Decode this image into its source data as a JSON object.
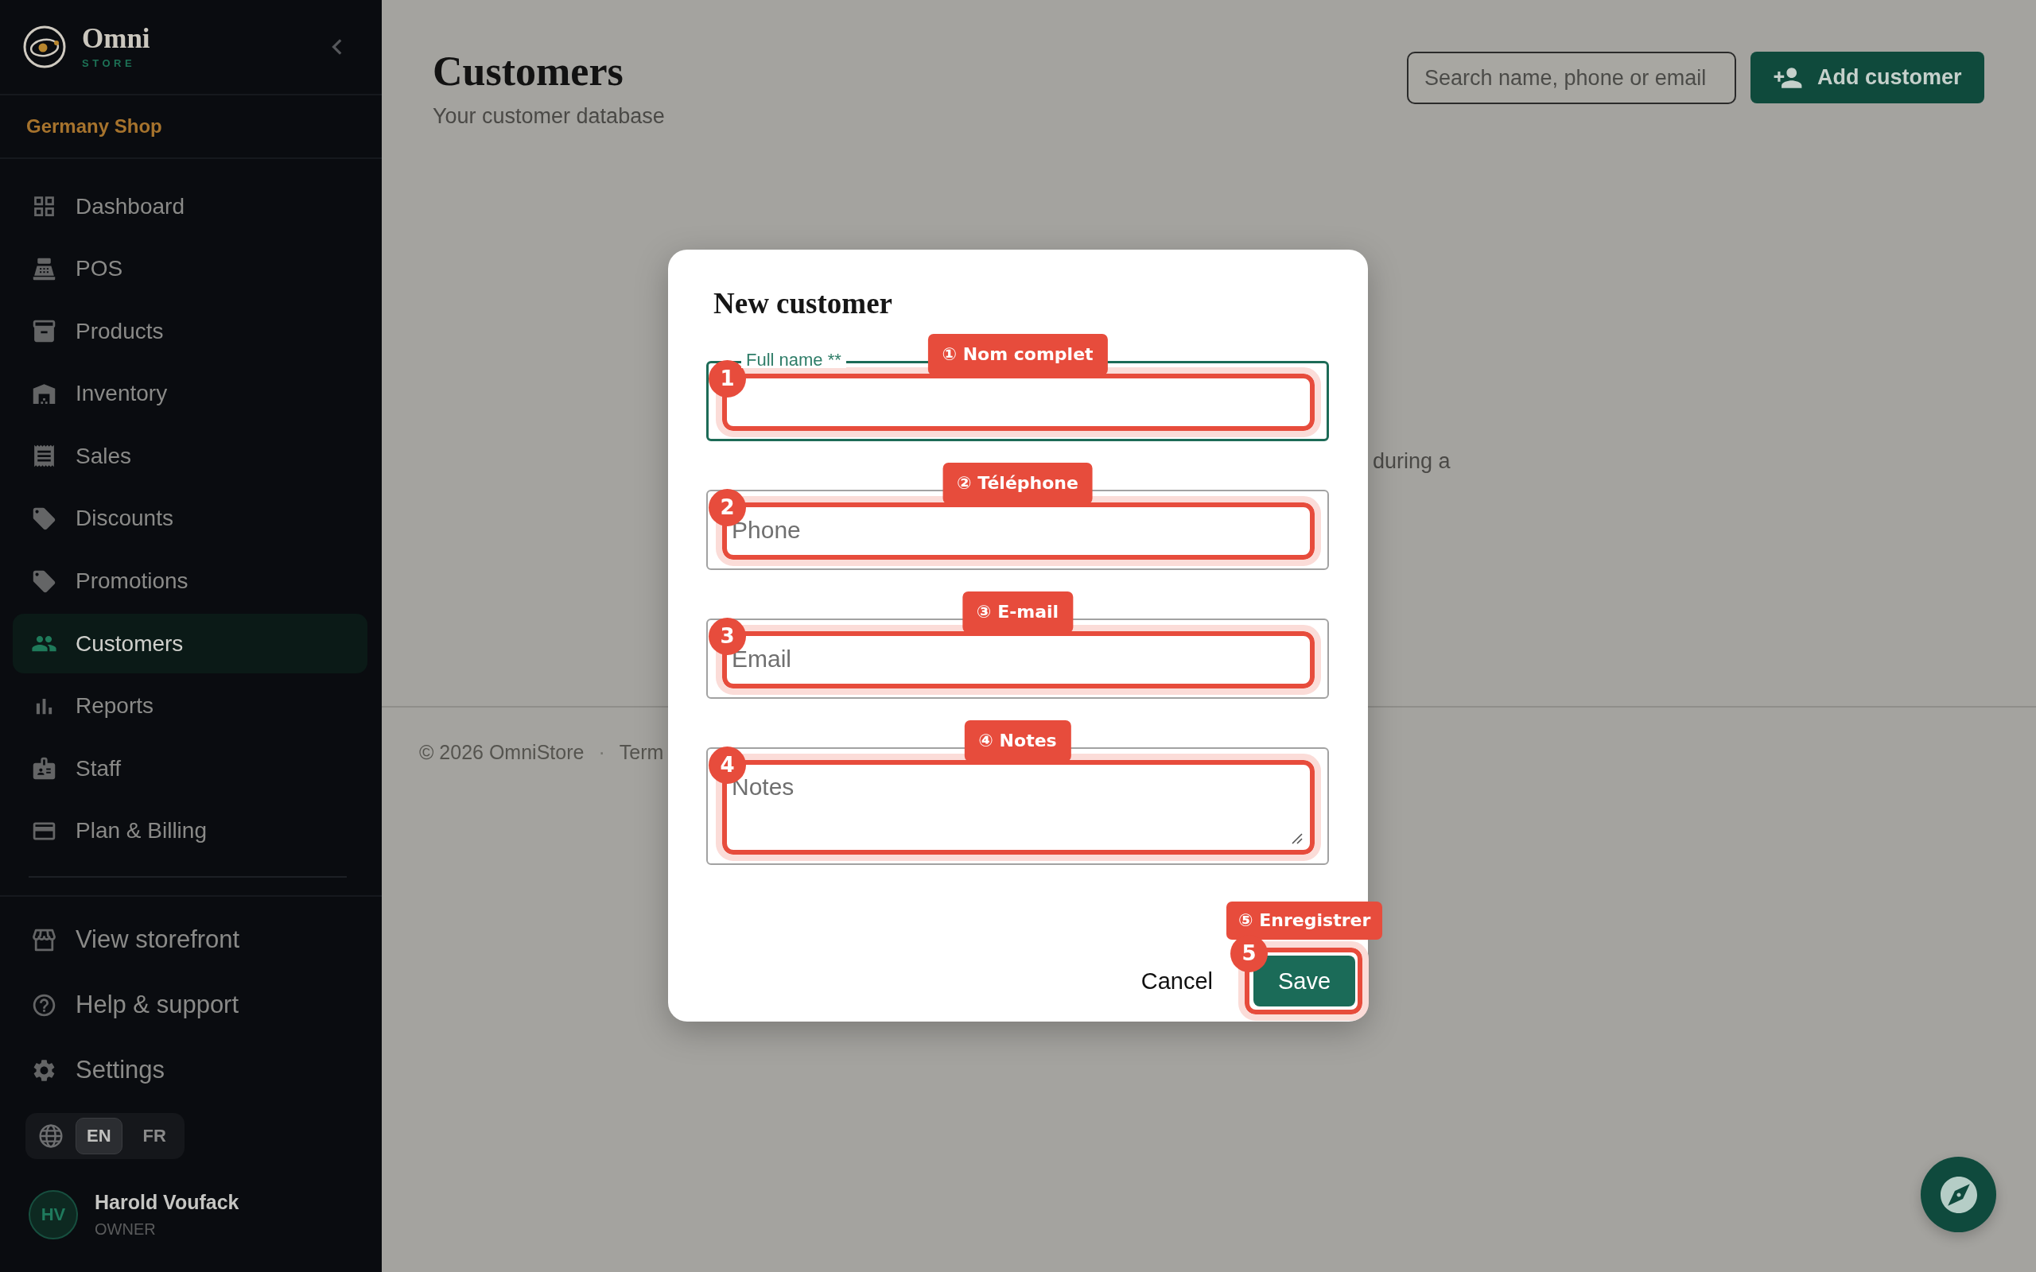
{
  "sidebar": {
    "brand": {
      "name": "Omni",
      "tagline": "STORE"
    },
    "shop": "Germany Shop",
    "nav": [
      {
        "label": "Dashboard",
        "selected": false
      },
      {
        "label": "POS",
        "selected": false
      },
      {
        "label": "Products",
        "selected": false
      },
      {
        "label": "Inventory",
        "selected": false
      },
      {
        "label": "Sales",
        "selected": false
      },
      {
        "label": "Discounts",
        "selected": false
      },
      {
        "label": "Promotions",
        "selected": false
      },
      {
        "label": "Customers",
        "selected": true
      },
      {
        "label": "Reports",
        "selected": false
      },
      {
        "label": "Staff",
        "selected": false
      },
      {
        "label": "Plan & Billing",
        "selected": false
      }
    ],
    "links": [
      {
        "label": "View storefront"
      },
      {
        "label": "Help & support"
      },
      {
        "label": "Settings"
      }
    ],
    "languages": [
      {
        "label": "EN",
        "selected": true
      },
      {
        "label": "FR",
        "selected": false
      }
    ],
    "user": {
      "initials": "HV",
      "name": "Harold Voufack",
      "role": "OWNER"
    }
  },
  "header": {
    "title": "Customers",
    "subtitle": "Your customer database",
    "search": {
      "placeholder": "Search name, phone or email"
    },
    "add_button": "Add customer"
  },
  "content": {
    "text_fragment": "during a"
  },
  "footer": {
    "copyright": "© 2026 OmniStore",
    "separator": "·",
    "link": "Term"
  },
  "dialog": {
    "title": "New customer",
    "fields": [
      {
        "kind": "text",
        "label": "Full name **",
        "focused": true,
        "annotation": {
          "number": "1",
          "callout": "① Nom complet"
        }
      },
      {
        "kind": "text",
        "placeholder": "Phone",
        "focused": false,
        "annotation": {
          "number": "2",
          "callout": "② Téléphone"
        }
      },
      {
        "kind": "text",
        "placeholder": "Email",
        "focused": false,
        "annotation": {
          "number": "3",
          "callout": "③ E-mail"
        }
      },
      {
        "kind": "textarea",
        "placeholder": "Notes",
        "focused": false,
        "annotation": {
          "number": "4",
          "callout": "④ Notes"
        }
      }
    ],
    "cancel_button": "Cancel",
    "save_button": {
      "label": "Save",
      "annotation": {
        "number": "5",
        "callout": "⑤ Enregistrer"
      }
    }
  }
}
